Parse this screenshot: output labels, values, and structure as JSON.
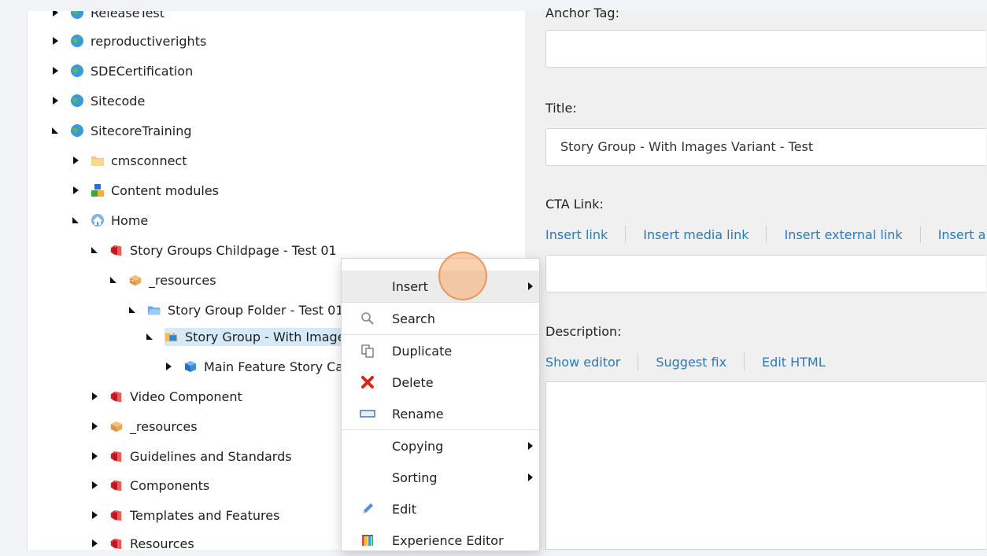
{
  "tree": {
    "nodes": [
      {
        "label": "ReleaseTest",
        "icon": "globe-icon",
        "expanded": false
      },
      {
        "label": "reproductiverights",
        "icon": "globe-icon",
        "expanded": false
      },
      {
        "label": "SDECertification",
        "icon": "globe-icon",
        "expanded": false
      },
      {
        "label": "Sitecode",
        "icon": "globe-icon",
        "expanded": false
      },
      {
        "label": "SitecoreTraining",
        "icon": "globe-icon",
        "expanded": true
      },
      {
        "label": "cmsconnect",
        "icon": "folder-icon",
        "expanded": false
      },
      {
        "label": "Content modules",
        "icon": "modules-icon",
        "expanded": false
      },
      {
        "label": "Home",
        "icon": "home-icon",
        "expanded": true
      },
      {
        "label": "Story Groups Childpage - Test 01",
        "icon": "page-icon",
        "expanded": true
      },
      {
        "label": "_resources",
        "icon": "box-icon",
        "expanded": true
      },
      {
        "label": "Story Group Folder - Test 01",
        "icon": "blue-folder-icon",
        "expanded": true
      },
      {
        "label": "Story Group - With Images Variant - Test",
        "icon": "story-group-icon",
        "expanded": true,
        "selected": true
      },
      {
        "label": "Main Feature Story Card",
        "icon": "cube-icon",
        "expanded": false
      },
      {
        "label": "Video Component",
        "icon": "page-icon",
        "expanded": false
      },
      {
        "label": "_resources",
        "icon": "box-icon",
        "expanded": false
      },
      {
        "label": "Guidelines and Standards",
        "icon": "page-icon",
        "expanded": false
      },
      {
        "label": "Components",
        "icon": "page-icon",
        "expanded": false
      },
      {
        "label": "Templates and Features",
        "icon": "page-icon",
        "expanded": false
      },
      {
        "label": "Resources",
        "icon": "page-icon",
        "expanded": false
      }
    ]
  },
  "panel": {
    "anchor_label": "Anchor Tag:",
    "title_label": "Title:",
    "title_value": "Story Group - With Images Variant - Test",
    "cta_label": "CTA Link:",
    "cta_links": [
      "Insert link",
      "Insert media link",
      "Insert external link",
      "Insert a"
    ],
    "description_label": "Description:",
    "description_links": [
      "Show editor",
      "Suggest fix",
      "Edit HTML"
    ]
  },
  "context_menu": {
    "items": [
      {
        "label": "Insert",
        "icon": "",
        "submenu": true
      },
      {
        "label": "Search",
        "icon": "search-icon"
      },
      {
        "label": "Duplicate",
        "icon": "duplicate-icon"
      },
      {
        "label": "Delete",
        "icon": "delete-icon"
      },
      {
        "label": "Rename",
        "icon": "rename-icon"
      },
      {
        "label": "Copying",
        "icon": "",
        "submenu": true
      },
      {
        "label": "Sorting",
        "icon": "",
        "submenu": true
      },
      {
        "label": "Edit",
        "icon": "pencil-icon"
      },
      {
        "label": "Experience Editor",
        "icon": "experience-editor-icon"
      }
    ]
  },
  "colors": {
    "link": "#2a7ab8",
    "selection": "#d6e9f8",
    "cursor_highlight": "#f5aa6e",
    "delete_red": "#d7261e"
  }
}
